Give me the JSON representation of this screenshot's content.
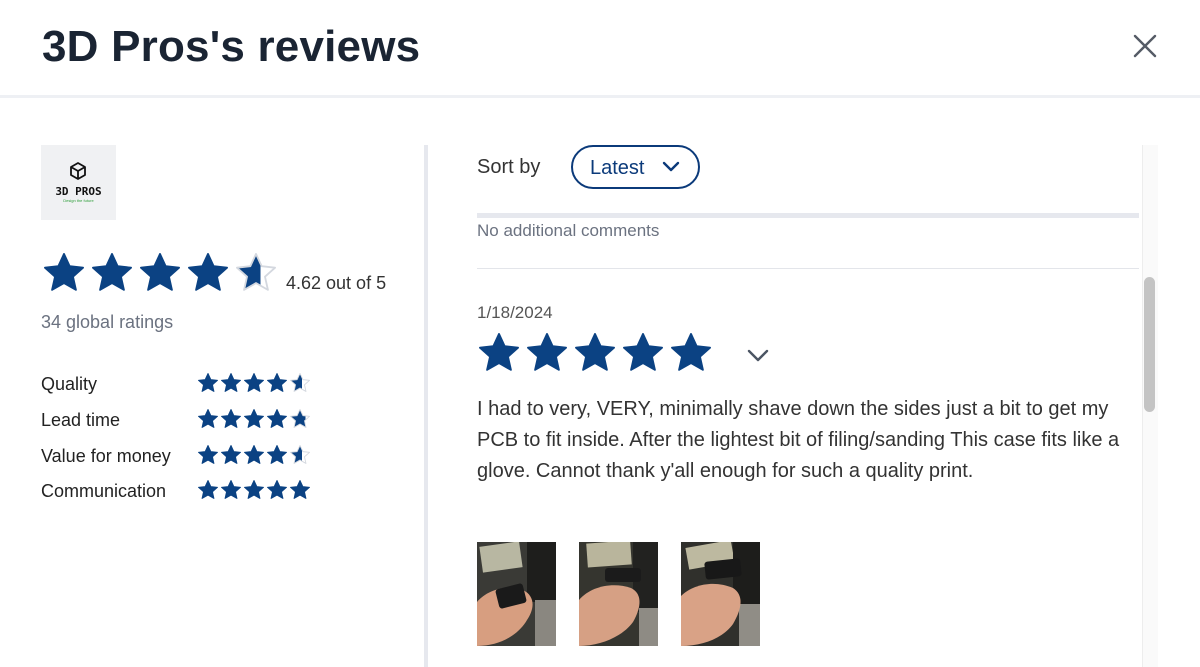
{
  "header": {
    "title": "3D Pros's reviews"
  },
  "seller": {
    "logo_text": "3D PROS",
    "logo_tagline": "Design the future",
    "rating_value": 4.62,
    "rating_text": "4.62 out of 5",
    "global_ratings": "34 global ratings",
    "criteria": [
      {
        "label": "Quality",
        "rating": 4.6
      },
      {
        "label": "Lead time",
        "rating": 4.8
      },
      {
        "label": "Value for money",
        "rating": 4.6
      },
      {
        "label": "Communication",
        "rating": 5.0
      }
    ]
  },
  "sort": {
    "label": "Sort by",
    "value": "Latest"
  },
  "previous_review": {
    "comment": "No additional comments"
  },
  "review": {
    "date": "1/18/2024",
    "rating": 5,
    "text": "I had to very, VERY, minimally shave down the sides just a bit to get my PCB to fit inside. After the lightest bit of filing/sanding This case fits like a glove. Cannot thank y'all enough for such a quality print.",
    "photo_count": 3
  },
  "colors": {
    "star": "#0b4283",
    "star_empty": "#d4d8df",
    "accent": "#0b3a7a"
  },
  "icons": {
    "close": "close-icon",
    "chevron": "chevron-down-icon",
    "star": "star-icon",
    "logo": "cube-icon"
  }
}
